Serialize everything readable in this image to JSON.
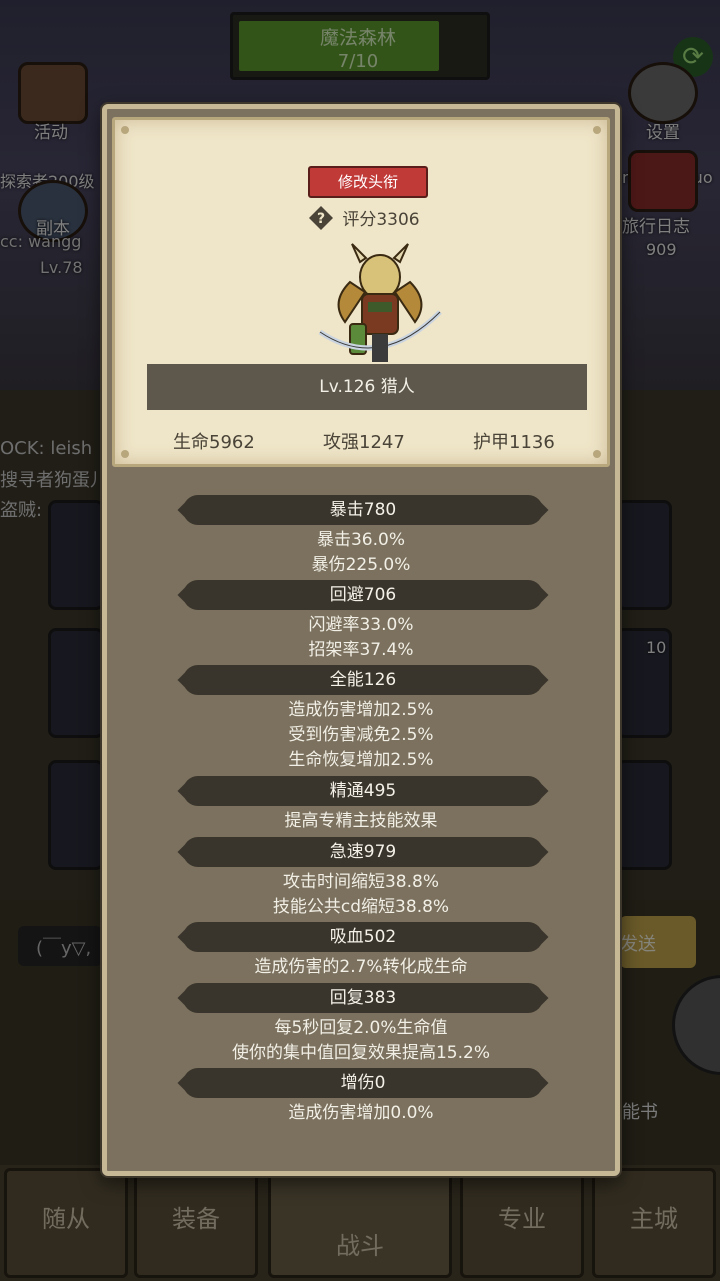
{
  "background": {
    "stage": {
      "name": "魔法森林",
      "progress": "7/10"
    },
    "left_icons": [
      {
        "label": "活动",
        "icon": "activity-icon"
      },
      {
        "label": "副本",
        "icon": "dungeon-icon"
      }
    ],
    "right_icons": [
      {
        "label": "设置",
        "icon": "gear-icon"
      },
      {
        "label": "旅行日志",
        "icon": "journal-icon"
      }
    ],
    "partial_texts": {
      "left_title": "探索者200级",
      "left_name": "cc: wangg",
      "left_level": "Lv.78",
      "right_name": "nguanghuo",
      "right_count": "909",
      "badge_count": "10"
    },
    "chat": {
      "line1": "OCK: leish",
      "line2": "搜寻者狗蛋儿",
      "line3": "盗贼: o(*",
      "input_placeholder": "(￣y▽,",
      "send_label": "发送",
      "skillbook_label": "能书"
    },
    "nav": {
      "tabs": [
        "随从",
        "装备",
        "战斗",
        "专业",
        "主城"
      ]
    }
  },
  "modal": {
    "title_button": "修改头衔",
    "score_label": "评分3306",
    "character": "Lv.126 猎人",
    "stats": {
      "hp": "生命5962",
      "attack": "攻强1247",
      "armor": "护甲1136"
    },
    "attributes": [
      {
        "name": "暴击780",
        "details": [
          "暴击36.0%",
          "暴伤225.0%"
        ]
      },
      {
        "name": "回避706",
        "details": [
          "闪避率33.0%",
          "招架率37.4%"
        ]
      },
      {
        "name": "全能126",
        "details": [
          "造成伤害增加2.5%",
          "受到伤害减免2.5%",
          "生命恢复增加2.5%"
        ]
      },
      {
        "name": "精通495",
        "details": [
          "提高专精主技能效果"
        ]
      },
      {
        "name": "急速979",
        "details": [
          "攻击时间缩短38.8%",
          "技能公共cd缩短38.8%"
        ]
      },
      {
        "name": "吸血502",
        "details": [
          "造成伤害的2.7%转化成生命"
        ]
      },
      {
        "name": "回复383",
        "details": [
          "每5秒回复2.0%生命值",
          "使你的集中值回复效果提高15.2%"
        ]
      },
      {
        "name": "增伤0",
        "details": [
          "造成伤害增加0.0%"
        ]
      }
    ]
  },
  "colors": {
    "modal_bg": "#7b715e",
    "parchment": "#efe5c8",
    "title_button": "#c03a38",
    "attr_header": "#3a352c"
  }
}
